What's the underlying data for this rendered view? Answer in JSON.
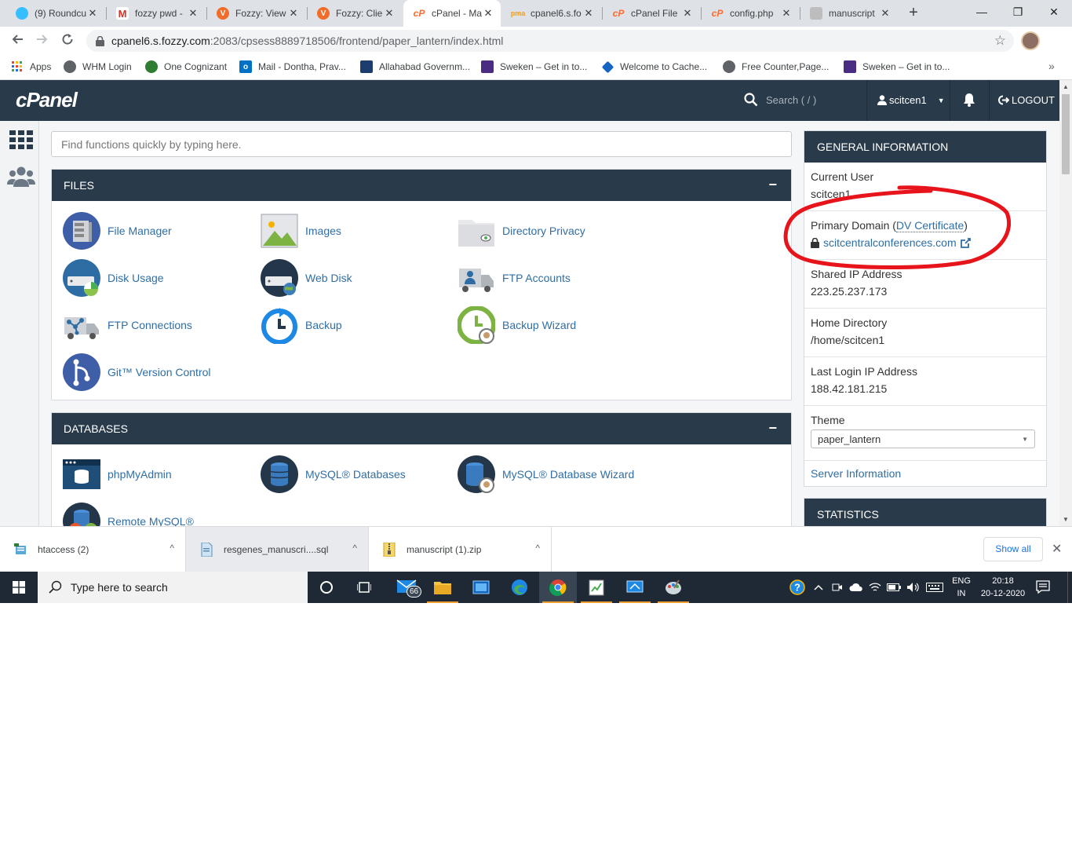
{
  "browser": {
    "tabs": [
      {
        "title": "(9) Roundcu",
        "icon": "roundcube-icon",
        "color": "#37beff"
      },
      {
        "title": "fozzy pwd -",
        "icon": "gmail-icon",
        "color": "#d93025"
      },
      {
        "title": "Fozzy: View",
        "icon": "fozzy-icon",
        "color": "#f26c2a"
      },
      {
        "title": "Fozzy: Clien",
        "icon": "fozzy-icon",
        "color": "#f26c2a"
      },
      {
        "title": "cPanel - Ma",
        "icon": "cpanel-icon",
        "color": "#ff6c2c"
      },
      {
        "title": "cpanel6.s.fo",
        "icon": "phpmyadmin-icon",
        "color": "#f89c0e"
      },
      {
        "title": "cPanel File",
        "icon": "cpanel-icon",
        "color": "#ff6c2c"
      },
      {
        "title": "config.php",
        "icon": "cpanel-icon",
        "color": "#ff6c2c"
      },
      {
        "title": "manuscript",
        "icon": "file-icon",
        "color": "#9e9e9e"
      }
    ],
    "url_host": "cpanel6.s.fozzy.com",
    "url_path": ":2083/cpsess8889718506/frontend/paper_lantern/index.html",
    "bookmarks": [
      {
        "label": "Apps",
        "icon": "apps-grid-icon"
      },
      {
        "label": "WHM Login",
        "icon": "globe-icon"
      },
      {
        "label": "One Cognizant",
        "icon": "cognizant-icon"
      },
      {
        "label": "Mail - Dontha, Prav...",
        "icon": "outlook-icon"
      },
      {
        "label": "Allahabad Governm...",
        "icon": "school-icon"
      },
      {
        "label": "Sweken – Get in to...",
        "icon": "sweken-icon"
      },
      {
        "label": "Welcome to Cache...",
        "icon": "cache-icon"
      },
      {
        "label": "Free Counter,Page...",
        "icon": "globe-icon"
      },
      {
        "label": "Sweken – Get in to...",
        "icon": "sweken-icon"
      }
    ]
  },
  "cpanel": {
    "logo": "cPanel",
    "search_placeholder": "Search ( / )",
    "username": "scitcen1",
    "logout": "LOGOUT",
    "quickfind_placeholder": "Find functions quickly by typing here.",
    "files": {
      "title": "FILES",
      "items": [
        "File Manager",
        "Images",
        "Directory Privacy",
        "Disk Usage",
        "Web Disk",
        "FTP Accounts",
        "FTP Connections",
        "Backup",
        "Backup Wizard",
        "Git™ Version Control"
      ]
    },
    "databases": {
      "title": "DATABASES",
      "items": [
        "phpMyAdmin",
        "MySQL® Databases",
        "MySQL® Database Wizard",
        "Remote MySQL®"
      ]
    },
    "general_info": {
      "title": "GENERAL INFORMATION",
      "current_user_label": "Current User",
      "current_user": "scitcen1",
      "primary_domain_label": "Primary Domain (",
      "dv_label": "DV Certificate",
      "primary_domain_close": ")",
      "primary_domain": "scitcentralconferences.com",
      "shared_ip_label": "Shared IP Address",
      "shared_ip": "223.25.237.173",
      "home_dir_label": "Home Directory",
      "home_dir": "/home/scitcen1",
      "last_login_label": "Last Login IP Address",
      "last_login": "188.42.181.215",
      "theme_label": "Theme",
      "theme": "paper_lantern",
      "server_info": "Server Information"
    },
    "statistics": {
      "title": "STATISTICS"
    },
    "annotation_color": "#e8141b"
  },
  "downloads": {
    "items": [
      {
        "name": "htaccess (2)",
        "icon": "file-icon"
      },
      {
        "name": "resgenes_manuscri....sql",
        "icon": "sql-file-icon"
      },
      {
        "name": "manuscript (1).zip",
        "icon": "zip-icon"
      }
    ],
    "show_all": "Show all"
  },
  "taskbar": {
    "search_placeholder": "Type here to search",
    "mail_badge": "66",
    "lang_top": "ENG",
    "lang_bottom": "IN",
    "time": "20:18",
    "date": "20-12-2020"
  }
}
